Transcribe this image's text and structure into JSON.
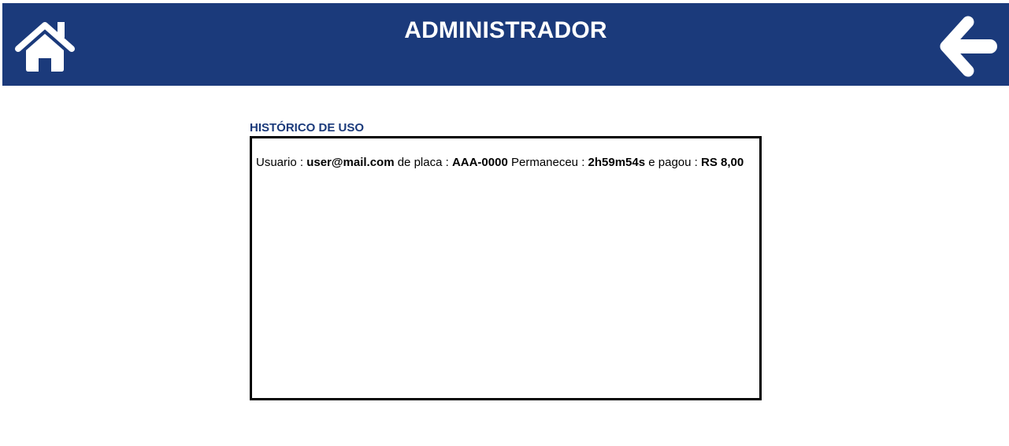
{
  "header": {
    "title": "ADMINISTRADOR",
    "home_icon": "home-icon",
    "back_icon": "arrow-left-icon",
    "background_color": "#1b3a7b"
  },
  "history": {
    "label": "HISTÓRICO DE USO",
    "entries": [
      {
        "user_label": "Usuario : ",
        "user": "user@mail.com",
        "plate_label": " de placa : ",
        "plate": "AAA-0000",
        "duration_label": " Permaneceu : ",
        "duration": "2h59m54s",
        "paid_label": " e pagou : ",
        "paid": "RS 8,00"
      }
    ]
  }
}
